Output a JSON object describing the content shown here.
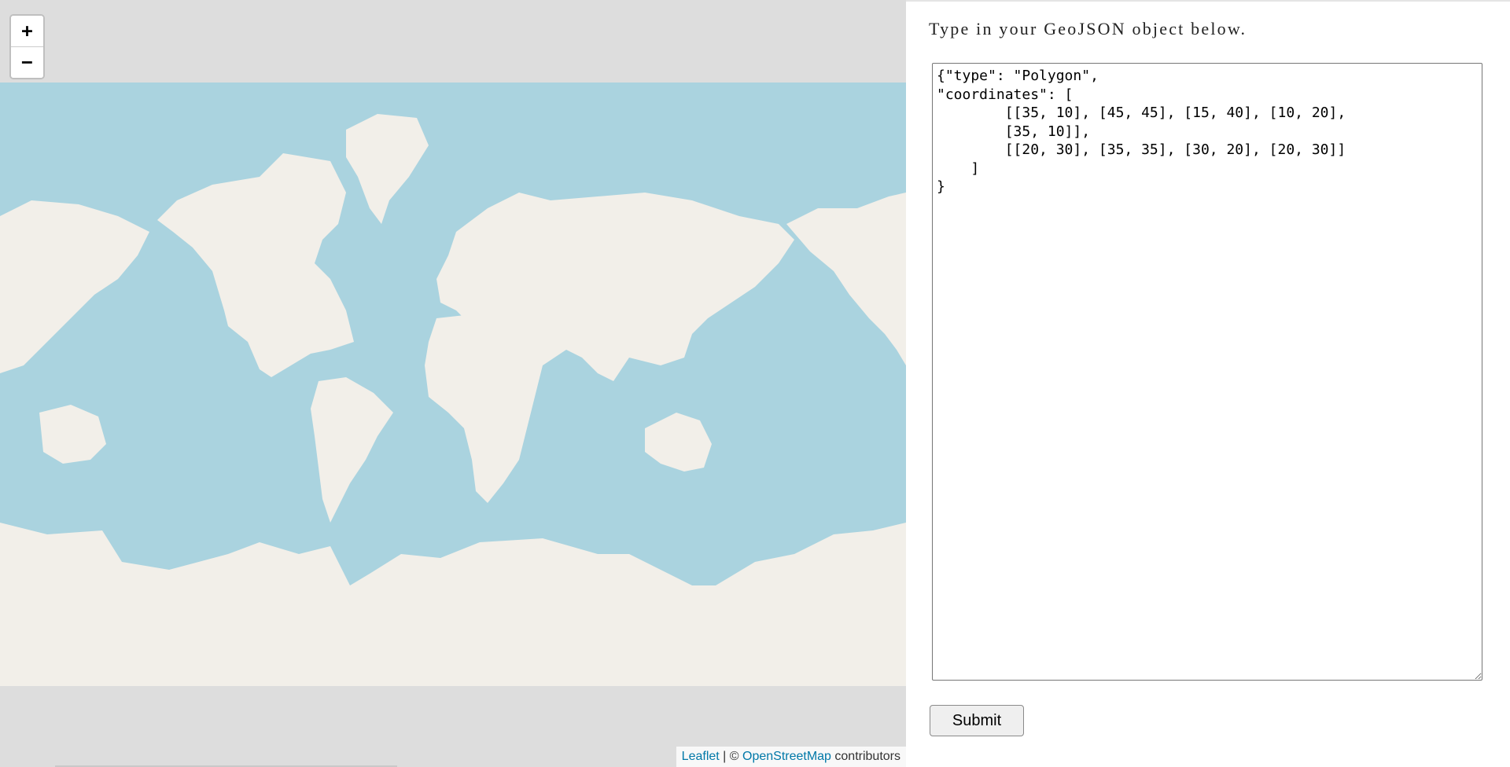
{
  "map": {
    "zoom_in_label": "+",
    "zoom_out_label": "−",
    "attribution": {
      "leaflet_link": "Leaflet",
      "separator": " | © ",
      "osm_link": "OpenStreetMap",
      "suffix": " contributors"
    },
    "colors": {
      "ocean": "#aad3df",
      "land": "#f2efe9",
      "background": "#dddddd",
      "borders": "#c6a6bf",
      "link": "#0078a8"
    }
  },
  "form": {
    "instructions": "Type in your GeoJSON object below.",
    "geojson_value": "{\"type\": \"Polygon\",\n\"coordinates\": [\n        [[35, 10], [45, 45], [15, 40], [10, 20],\n        [35, 10]],\n        [[20, 30], [35, 35], [30, 20], [20, 30]]\n    ]\n}",
    "submit_label": "Submit"
  }
}
